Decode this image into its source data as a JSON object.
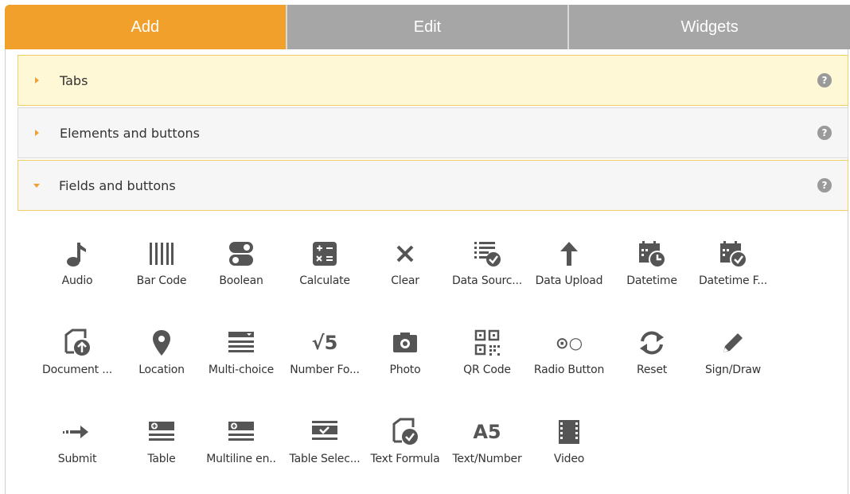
{
  "tabs": [
    {
      "label": "Add"
    },
    {
      "label": "Edit"
    },
    {
      "label": "Widgets"
    }
  ],
  "sections": [
    {
      "label": "Tabs"
    },
    {
      "label": "Elements and buttons"
    },
    {
      "label": "Fields and buttons"
    }
  ],
  "help_label": "?",
  "fields": [
    {
      "label": "Audio",
      "icon": "music-note-icon"
    },
    {
      "label": "Bar Code",
      "icon": "barcode-icon"
    },
    {
      "label": "Boolean",
      "icon": "toggle-icon"
    },
    {
      "label": "Calculate",
      "icon": "calculator-icon"
    },
    {
      "label": "Clear",
      "icon": "close-icon"
    },
    {
      "label": "Data Sourc...",
      "icon": "data-source-icon"
    },
    {
      "label": "Data Upload",
      "icon": "arrow-up-icon"
    },
    {
      "label": "Datetime",
      "icon": "calendar-clock-icon"
    },
    {
      "label": "Datetime F...",
      "icon": "calendar-check-icon"
    },
    {
      "label": "Document ...",
      "icon": "document-upload-icon"
    },
    {
      "label": "Location",
      "icon": "location-pin-icon"
    },
    {
      "label": "Multi-choice",
      "icon": "list-dropdown-icon"
    },
    {
      "label": "Number Fo...",
      "icon": "square-root-icon",
      "glyph": "√5"
    },
    {
      "label": "Photo",
      "icon": "camera-icon"
    },
    {
      "label": "QR Code",
      "icon": "qr-code-icon"
    },
    {
      "label": "Radio Button",
      "icon": "radio-icon",
      "glyph": "⊙○"
    },
    {
      "label": "Reset",
      "icon": "refresh-icon"
    },
    {
      "label": "Sign/Draw",
      "icon": "pencil-icon"
    },
    {
      "label": "Submit",
      "icon": "arrow-right-icon"
    },
    {
      "label": "Table",
      "icon": "table-add-icon"
    },
    {
      "label": "Multiline en..",
      "icon": "multiline-add-icon"
    },
    {
      "label": "Table Selec...",
      "icon": "table-select-icon"
    },
    {
      "label": "Text Formula",
      "icon": "text-formula-icon"
    },
    {
      "label": "Text/Number",
      "icon": "text-number-icon",
      "glyph": "A5"
    },
    {
      "label": "Video",
      "icon": "film-icon"
    }
  ],
  "colors": {
    "accent": "#f2a02c",
    "inactive_tab": "#a6a6a6",
    "icon": "#555555"
  }
}
